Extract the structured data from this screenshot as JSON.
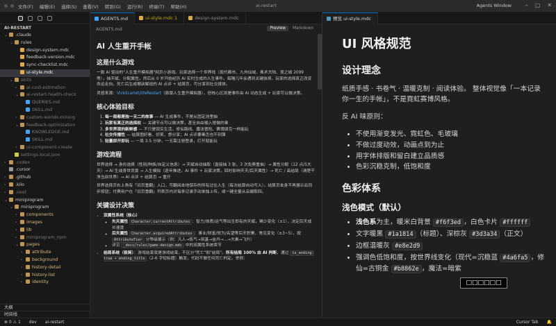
{
  "titlebar": {
    "menus": [
      "文件(F)",
      "编辑(E)",
      "选择(S)",
      "查看(V)",
      "转到(G)",
      "运行(R)",
      "终端(T)",
      "帮助(H)"
    ],
    "window_title": "ai-restart",
    "right_label": "Agents Window"
  },
  "sidebar": {
    "root": "AI-RESTART",
    "tree": [
      {
        "label": ".claude",
        "depth": 1,
        "kind": "folder",
        "open": true
      },
      {
        "label": "rules",
        "depth": 2,
        "kind": "folder",
        "open": true
      },
      {
        "label": "design-system.mdc",
        "depth": 3,
        "kind": "mdc"
      },
      {
        "label": "feedback-version.mdc",
        "depth": 3,
        "kind": "mdc"
      },
      {
        "label": "sync-checklist.mdc",
        "depth": 3,
        "kind": "mdc"
      },
      {
        "label": "ui-style.mdc",
        "depth": 3,
        "kind": "mdc",
        "selected": true
      },
      {
        "label": "skills",
        "depth": 2,
        "kind": "folder",
        "open": true,
        "tone": "dim"
      },
      {
        "label": "ai-cost-estimation",
        "depth": 3,
        "kind": "folder",
        "tone": "dim"
      },
      {
        "label": "ai-restart-health-check",
        "depth": 3,
        "kind": "folder",
        "open": true,
        "tone": "dim"
      },
      {
        "label": "QUERIES.md",
        "depth": 4,
        "kind": "md",
        "tone": "dim"
      },
      {
        "label": "SKILL.md",
        "depth": 4,
        "kind": "md",
        "tone": "dim"
      },
      {
        "label": "custom-worlds-mining",
        "depth": 3,
        "kind": "folder",
        "tone": "dim"
      },
      {
        "label": "feedback-optimization",
        "depth": 3,
        "kind": "folder",
        "open": true,
        "tone": "dim"
      },
      {
        "label": "KNOWLEDGE.md",
        "depth": 4,
        "kind": "md",
        "tone": "dim"
      },
      {
        "label": "SKILL.md",
        "depth": 4,
        "kind": "md",
        "tone": "dim"
      },
      {
        "label": "ui-component-create",
        "depth": 3,
        "kind": "folder",
        "tone": "dim"
      },
      {
        "label": "settings.local.json",
        "depth": 2,
        "kind": "json",
        "tone": "dim"
      },
      {
        "label": ".codex",
        "depth": 1,
        "kind": "folder",
        "tone": "dim"
      },
      {
        "label": ".cursor",
        "depth": 1,
        "kind": "cursor"
      },
      {
        "label": ".github",
        "depth": 1,
        "kind": "folder"
      },
      {
        "label": ".kilo",
        "depth": 1,
        "kind": "folder"
      },
      {
        "label": ".next",
        "depth": 1,
        "kind": "folder",
        "tone": "dim"
      },
      {
        "label": "miniprogram",
        "depth": 1,
        "kind": "folder",
        "open": true
      },
      {
        "label": "miniprogram",
        "depth": 2,
        "kind": "folder",
        "open": true
      },
      {
        "label": "components",
        "depth": 3,
        "kind": "folder",
        "tone": "yellow"
      },
      {
        "label": "images",
        "depth": 3,
        "kind": "folder",
        "tone": "yellow"
      },
      {
        "label": "lib",
        "depth": 3,
        "kind": "folder",
        "tone": "yellow"
      },
      {
        "label": "miniprogram_npm",
        "depth": 3,
        "kind": "folder",
        "tone": "dim"
      },
      {
        "label": "pages",
        "depth": 3,
        "kind": "folder",
        "open": true,
        "tone": "yellow"
      },
      {
        "label": "attribute",
        "depth": 4,
        "kind": "folder",
        "tone": "yellow"
      },
      {
        "label": "background",
        "depth": 4,
        "kind": "folder",
        "tone": "yellow"
      },
      {
        "label": "history-detail",
        "depth": 4,
        "kind": "folder",
        "tone": "yellow"
      },
      {
        "label": "history-list",
        "depth": 4,
        "kind": "folder",
        "tone": "yellow"
      },
      {
        "label": "identity",
        "depth": 4,
        "kind": "folder",
        "tone": "yellow"
      }
    ],
    "bottom_sections": [
      "大纲",
      "时间线"
    ]
  },
  "editor": {
    "tabs": [
      {
        "label": "AGENTS.md",
        "active": true,
        "icon": "md"
      },
      {
        "label": "ui-style.mdc 1",
        "active": false,
        "icon": "mdc",
        "warn": true
      },
      {
        "label": "design-system.mdc",
        "active": false,
        "icon": "mdc"
      }
    ],
    "breadcrumb": "AGENTS.md",
    "mode_tabs": [
      "Preview",
      "Markdown"
    ],
    "doc": {
      "h1": "AI 人生重开手帐",
      "s1_title": "这是什么游戏",
      "s1_p1": "一款 AI 驱动的\"人生重开模拟器\"网页小游戏。玩家选择一个世界线（现代都市、九州仙域、奥术大陆、夜之城 2099 等），抽天赋、分配属性，然后从 0 岁开始经历 AI 实时生成的人生事件。每隔几年会遇到关键抉择，玩家的选择真正改变命运走向。死亡后生成嘲讽解说的 AI 点评 + 结算页，可分享到社交媒体。",
      "s1_p2_pre": "灵感来源：",
      "s1_p2_link": "VickScarlet/lifeRestart",
      "s1_p2_post": "（原版人生重开模拟器），但核心区别是事件由 AI 动态生成 + 玩家可以做决策。",
      "s2_title": "核心体验目标",
      "s2_items": [
        {
          "b": "每一局都是独一无二的故事",
          "t": " — AI 生成事件，不是从固定池里抽"
        },
        {
          "b": "玩家有真正的选择权",
          "t": " — 关键节点可以做决策，甚至自由输入想做的事"
        },
        {
          "b": "多世界观的新鲜感",
          "t": " — 不只是现实生活，修仙路线、魔法冒险、赛博朋克一样能玩"
        },
        {
          "b": "社交传播性",
          "t": " — 结算图好看、好笑、想分享；AI 点评要毒舌也不刻薄"
        },
        {
          "b": "轻量即开即玩",
          "t": " — 一局 3-5 分钟，一无需注册登录，打开就能玩"
        }
      ],
      "s3_title": "游戏流程",
      "s3_p1": "世界选择 → 身份选择（性别/种族/自定义信息）→ 天赋自动抽取（直接抽 3 张，3 次免费重抽）→ 属性分配（12 点/5大天）→ AI 生成身世背景 → 人生模拟（逐年推进，AI 事件 + 玩家决策，回时影响天天/后天属性）→ 死亡 / 高结局（清楚干净当前世界）→ AI 点评 + 结算页 → 重开",
      "s3_p2": "世界选择页右上角有「旧页重翻」入口，可翻阅本地保存的所有过往人生（每次结算自动写入）。结算页本身不再展示云同步按钮；付费用户在「旧页重翻」列表页内对每条记录手动单独上传，或一键全量从云端取回。",
      "s4_title": "关键设计决策",
      "s4_attr_head": "双属性系统（核心）",
      "s4_attr_1a": "先天属性",
      "s4_attr_1code": "Character.currentAttributes",
      "s4_attr_1b": "：智力/体质/运气等出生即有的天赋，稀少变化（±1），决定后天成长速度",
      "s4_attr_2a": "后天属性",
      "s4_attr_2code": "Character.acquiredAttributes",
      "s4_attr_2b": "：事业/财富/修为/名望等后天积累，常见变化（±3~5），按",
      "s4_attr_2c": "AttributeTier",
      "s4_attr_2d": " 分等级展示（例：凡人→炼气→筑基→金丹→...→大乘→飞升）",
      "s4_attr_3pre": "详见",
      "s4_attr_3code": "_docs/rules/game-design.mdc",
      "s4_attr_3post": " 中的双属性系统章节",
      "s4_judge_b": "结局系统（极简）",
      "s4_judge_t": "：游戏结束就是游戏结束，不区分\"死亡\"和\"结局\"。",
      "s4_judge_b2": "所有结局 100% 由 AI 判断",
      "s4_judge_t2": "，通过",
      "s4_judge_code": "is_ending: true + ending_title",
      "s4_judge_t3": "（2-6 字短标题）触发，代码不做任何死亡判定。举例："
    }
  },
  "preview": {
    "tab_label": "预览 ui-style.mdc",
    "h1": "UI 风格规范",
    "sec1": "设计理念",
    "p1": "纸质手感 · 书卷气 · 温暖克制 · 阅读体验。 整体视觉像「一本记录你一生的手帐」，不是霓虹赛博风格。",
    "p2": "反 AI 味原则：",
    "anti_items": [
      "不使用渐变发光、霓虹色、毛玻璃",
      "不做过度动效，动画点到为止",
      "用字体排版和留白建立品质感",
      "色彩沉稳克制，低饱和度"
    ],
    "sec2": "色彩体系",
    "sub1": "浅色模式（默认）",
    "light": {
      "l1_b": "浅色系",
      "l1_t": "为主，暖米白背景 ",
      "l1_c1": "#f6f3ed",
      "l1_t2": "，白色卡片 ",
      "l1_c2": "#ffffff",
      "l2_t": "文字暖黑 ",
      "l2_c1": "#1a1814",
      "l2_t2": "（标题）、深棕灰 ",
      "l2_c2": "#3d3a34",
      "l2_t3": "（正文）",
      "l3_t": "边框温暖灰 ",
      "l3_c": "#e8e2d9",
      "l4_t": "强调色低饱和度，按世界线变化（现代=沉稳蓝 ",
      "l4_c1": "#4a6fa5",
      "l4_t2": "，修仙=古铜金 ",
      "l4_c2": "#b8862e",
      "l4_t3": "，魔法=暗紫"
    }
  },
  "statusbar": {
    "left": [
      "⊗ 0 ⚠ 1",
      "dev",
      "ai-restart"
    ],
    "right": [
      "Cursor Tab",
      "🔔"
    ]
  }
}
